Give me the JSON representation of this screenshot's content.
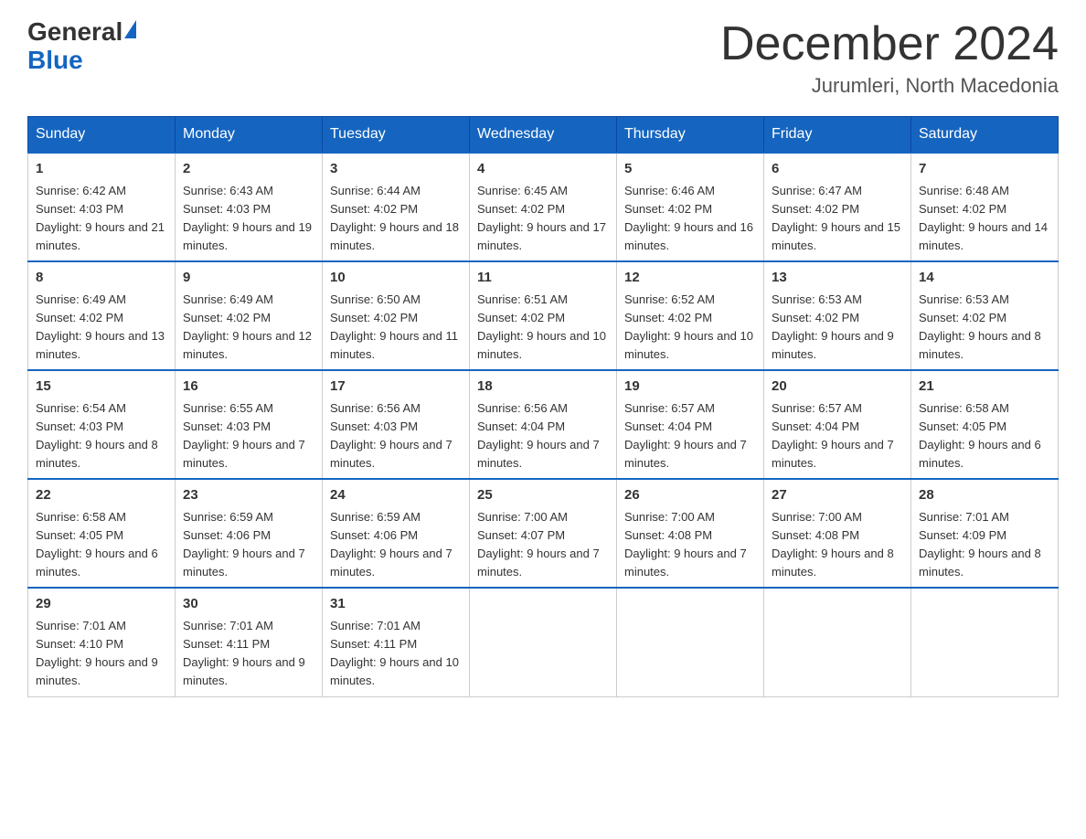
{
  "header": {
    "logo_general": "General",
    "logo_blue": "Blue",
    "month_title": "December 2024",
    "location": "Jurumleri, North Macedonia"
  },
  "weekdays": [
    "Sunday",
    "Monday",
    "Tuesday",
    "Wednesday",
    "Thursday",
    "Friday",
    "Saturday"
  ],
  "weeks": [
    [
      {
        "day": "1",
        "sunrise": "6:42 AM",
        "sunset": "4:03 PM",
        "daylight": "9 hours and 21 minutes."
      },
      {
        "day": "2",
        "sunrise": "6:43 AM",
        "sunset": "4:03 PM",
        "daylight": "9 hours and 19 minutes."
      },
      {
        "day": "3",
        "sunrise": "6:44 AM",
        "sunset": "4:02 PM",
        "daylight": "9 hours and 18 minutes."
      },
      {
        "day": "4",
        "sunrise": "6:45 AM",
        "sunset": "4:02 PM",
        "daylight": "9 hours and 17 minutes."
      },
      {
        "day": "5",
        "sunrise": "6:46 AM",
        "sunset": "4:02 PM",
        "daylight": "9 hours and 16 minutes."
      },
      {
        "day": "6",
        "sunrise": "6:47 AM",
        "sunset": "4:02 PM",
        "daylight": "9 hours and 15 minutes."
      },
      {
        "day": "7",
        "sunrise": "6:48 AM",
        "sunset": "4:02 PM",
        "daylight": "9 hours and 14 minutes."
      }
    ],
    [
      {
        "day": "8",
        "sunrise": "6:49 AM",
        "sunset": "4:02 PM",
        "daylight": "9 hours and 13 minutes."
      },
      {
        "day": "9",
        "sunrise": "6:49 AM",
        "sunset": "4:02 PM",
        "daylight": "9 hours and 12 minutes."
      },
      {
        "day": "10",
        "sunrise": "6:50 AM",
        "sunset": "4:02 PM",
        "daylight": "9 hours and 11 minutes."
      },
      {
        "day": "11",
        "sunrise": "6:51 AM",
        "sunset": "4:02 PM",
        "daylight": "9 hours and 10 minutes."
      },
      {
        "day": "12",
        "sunrise": "6:52 AM",
        "sunset": "4:02 PM",
        "daylight": "9 hours and 10 minutes."
      },
      {
        "day": "13",
        "sunrise": "6:53 AM",
        "sunset": "4:02 PM",
        "daylight": "9 hours and 9 minutes."
      },
      {
        "day": "14",
        "sunrise": "6:53 AM",
        "sunset": "4:02 PM",
        "daylight": "9 hours and 8 minutes."
      }
    ],
    [
      {
        "day": "15",
        "sunrise": "6:54 AM",
        "sunset": "4:03 PM",
        "daylight": "9 hours and 8 minutes."
      },
      {
        "day": "16",
        "sunrise": "6:55 AM",
        "sunset": "4:03 PM",
        "daylight": "9 hours and 7 minutes."
      },
      {
        "day": "17",
        "sunrise": "6:56 AM",
        "sunset": "4:03 PM",
        "daylight": "9 hours and 7 minutes."
      },
      {
        "day": "18",
        "sunrise": "6:56 AM",
        "sunset": "4:04 PM",
        "daylight": "9 hours and 7 minutes."
      },
      {
        "day": "19",
        "sunrise": "6:57 AM",
        "sunset": "4:04 PM",
        "daylight": "9 hours and 7 minutes."
      },
      {
        "day": "20",
        "sunrise": "6:57 AM",
        "sunset": "4:04 PM",
        "daylight": "9 hours and 7 minutes."
      },
      {
        "day": "21",
        "sunrise": "6:58 AM",
        "sunset": "4:05 PM",
        "daylight": "9 hours and 6 minutes."
      }
    ],
    [
      {
        "day": "22",
        "sunrise": "6:58 AM",
        "sunset": "4:05 PM",
        "daylight": "9 hours and 6 minutes."
      },
      {
        "day": "23",
        "sunrise": "6:59 AM",
        "sunset": "4:06 PM",
        "daylight": "9 hours and 7 minutes."
      },
      {
        "day": "24",
        "sunrise": "6:59 AM",
        "sunset": "4:06 PM",
        "daylight": "9 hours and 7 minutes."
      },
      {
        "day": "25",
        "sunrise": "7:00 AM",
        "sunset": "4:07 PM",
        "daylight": "9 hours and 7 minutes."
      },
      {
        "day": "26",
        "sunrise": "7:00 AM",
        "sunset": "4:08 PM",
        "daylight": "9 hours and 7 minutes."
      },
      {
        "day": "27",
        "sunrise": "7:00 AM",
        "sunset": "4:08 PM",
        "daylight": "9 hours and 8 minutes."
      },
      {
        "day": "28",
        "sunrise": "7:01 AM",
        "sunset": "4:09 PM",
        "daylight": "9 hours and 8 minutes."
      }
    ],
    [
      {
        "day": "29",
        "sunrise": "7:01 AM",
        "sunset": "4:10 PM",
        "daylight": "9 hours and 9 minutes."
      },
      {
        "day": "30",
        "sunrise": "7:01 AM",
        "sunset": "4:11 PM",
        "daylight": "9 hours and 9 minutes."
      },
      {
        "day": "31",
        "sunrise": "7:01 AM",
        "sunset": "4:11 PM",
        "daylight": "9 hours and 10 minutes."
      },
      null,
      null,
      null,
      null
    ]
  ]
}
